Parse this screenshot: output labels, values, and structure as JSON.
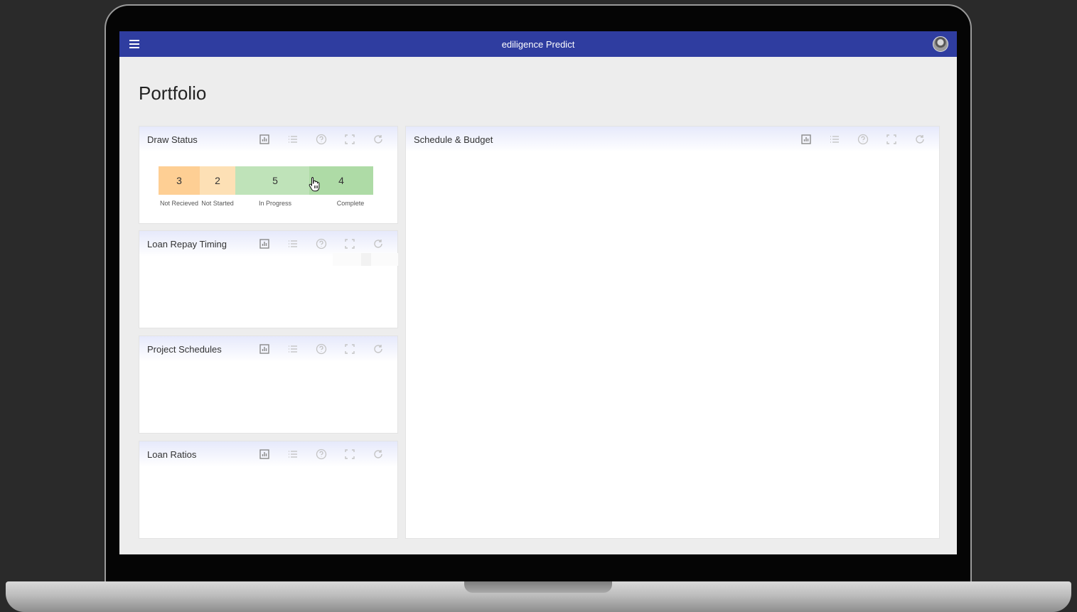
{
  "app": {
    "title": "ediligence Predict",
    "menu_icon": "hamburger-menu-icon",
    "avatar_icon": "user-avatar"
  },
  "page": {
    "title": "Portfolio"
  },
  "colors": {
    "appbar": "#2f3da0",
    "not_received": "#fecf94",
    "not_started": "#fde0b5",
    "in_progress": "#bfe3b9",
    "complete": "#aedba6"
  },
  "card_tools": [
    "chart-icon",
    "list-icon",
    "help-icon",
    "fullscreen-icon",
    "refresh-icon"
  ],
  "cards": {
    "draw_status": {
      "title": "Draw Status",
      "segments": [
        {
          "count": "3",
          "label": "Not Recieved",
          "color": "#fecf94"
        },
        {
          "count": "2",
          "label": "Not Started",
          "color": "#fde0b5"
        },
        {
          "count": "5",
          "label": "In Progress",
          "color": "#bfe3b9"
        },
        {
          "count": "4",
          "label": "Complete",
          "color": "#aedba6"
        }
      ]
    },
    "loan_repay_timing": {
      "title": "Loan Repay Timing"
    },
    "project_schedules": {
      "title": "Project Schedules"
    },
    "loan_ratios": {
      "title": "Loan Ratios"
    },
    "schedule_budget": {
      "title": "Schedule & Budget"
    }
  }
}
